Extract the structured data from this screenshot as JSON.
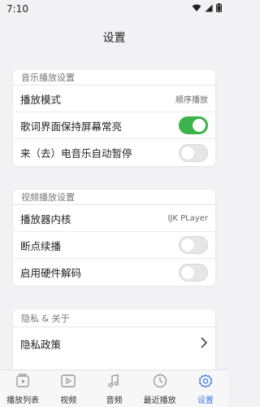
{
  "status_bar": {
    "time": "7:10"
  },
  "header": {
    "title": "设置"
  },
  "music_section": {
    "title": "音乐播放设置",
    "play_mode": {
      "label": "播放模式",
      "value": "顺序播放"
    },
    "lyrics_keep_screen_on": {
      "label": "歌词界面保持屏幕常亮",
      "on": true
    },
    "auto_pause_on_call": {
      "label": "来（去）电音乐自动暂停",
      "on": false
    }
  },
  "video_section": {
    "title": "视频播放设置",
    "player_core": {
      "label": "播放器内核",
      "value": "IJK PLayer"
    },
    "resume_playback": {
      "label": "断点续播",
      "on": false
    },
    "hardware_decode": {
      "label": "启用硬件解码",
      "on": false
    }
  },
  "privacy_section": {
    "title": "隐私 & 关于",
    "privacy_policy": {
      "label": "隐私政策"
    }
  },
  "bottom_nav": {
    "items": [
      {
        "label": "播放列表",
        "icon": "playlist-icon"
      },
      {
        "label": "视频",
        "icon": "video-icon"
      },
      {
        "label": "音频",
        "icon": "music-note-icon"
      },
      {
        "label": "最近播放",
        "icon": "clock-icon"
      },
      {
        "label": "设置",
        "icon": "gear-icon",
        "active": true
      }
    ],
    "active_color": "#3f7ae0"
  },
  "colors": {
    "toggle_on": "#3bb34a"
  }
}
